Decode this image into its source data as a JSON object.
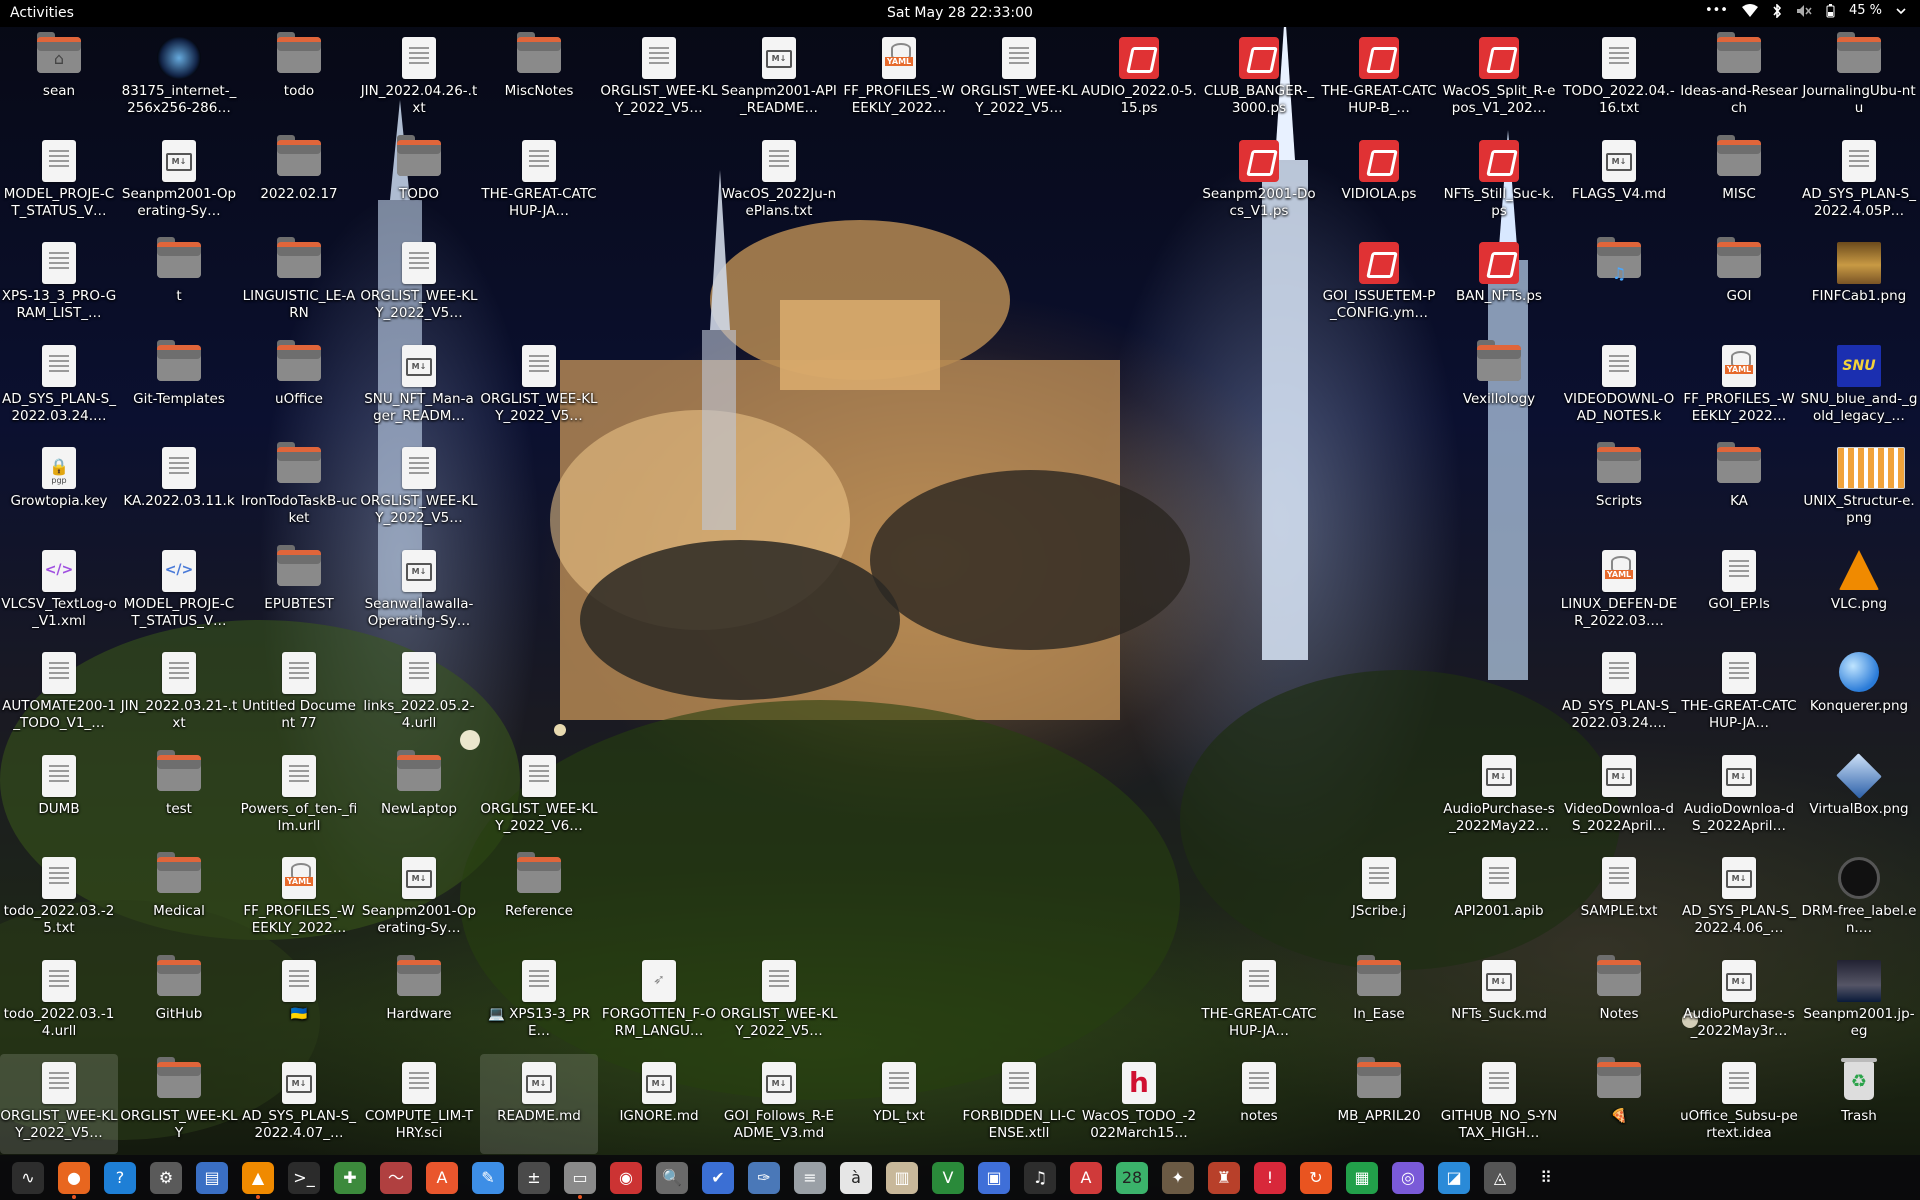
{
  "topbar": {
    "activities": "Activities",
    "clock": "Sat May 28  22:33:00",
    "menu_dots": "•••",
    "battery": "45 %"
  },
  "desktop_icons": [
    {
      "label": "sean",
      "icon": "home-folder-icon",
      "col": 0,
      "row": 0
    },
    {
      "label": "83175_internet-_256x256-286…",
      "icon": "internet-image-icon",
      "col": 1,
      "row": 0
    },
    {
      "label": "todo",
      "icon": "folder-icon",
      "col": 2,
      "row": 0
    },
    {
      "label": "JIN_2022.04.26-.txt",
      "icon": "text-file-icon",
      "col": 3,
      "row": 0
    },
    {
      "label": "MiscNotes",
      "icon": "folder-icon",
      "col": 4,
      "row": 0
    },
    {
      "label": "ORGLIST_WEE-KLY_2022_V5…",
      "icon": "text-file-icon",
      "col": 5,
      "row": 0
    },
    {
      "label": "Seanpm2001-API_README…",
      "icon": "markdown-file-icon",
      "col": 6,
      "row": 0
    },
    {
      "label": "FF_PROFILES_-WEEKLY_2022…",
      "icon": "yaml-file-icon",
      "col": 7,
      "row": 0
    },
    {
      "label": "ORGLIST_WEE-KLY_2022_V5…",
      "icon": "text-file-icon",
      "col": 8,
      "row": 0
    },
    {
      "label": "AUDIO_2022.0-5.15.ps",
      "icon": "postscript-file-icon",
      "col": 9,
      "row": 0
    },
    {
      "label": "CLUB_BANGER-_3000.ps",
      "icon": "postscript-file-icon",
      "col": 10,
      "row": 0
    },
    {
      "label": "THE-GREAT-CATCHUP-B_…",
      "icon": "postscript-file-icon",
      "col": 11,
      "row": 0
    },
    {
      "label": "WacOS_Split_R-epos_V1_202…",
      "icon": "postscript-file-icon",
      "col": 12,
      "row": 0
    },
    {
      "label": "TODO_2022.04.-16.txt",
      "icon": "text-file-icon",
      "col": 13,
      "row": 0
    },
    {
      "label": "Ideas-and-Research",
      "icon": "folder-icon",
      "col": 14,
      "row": 0
    },
    {
      "label": "JournalingUbu-ntu",
      "icon": "folder-icon",
      "col": 15,
      "row": 0
    },
    {
      "label": "MODEL_PROJE-CT_STATUS_V…",
      "icon": "text-file-icon",
      "col": 0,
      "row": 1
    },
    {
      "label": "Seanpm2001-Operating-Sy…",
      "icon": "markdown-file-icon",
      "col": 1,
      "row": 1
    },
    {
      "label": "2022.02.17",
      "icon": "folder-icon",
      "col": 2,
      "row": 1
    },
    {
      "label": "TODO",
      "icon": "folder-icon",
      "col": 3,
      "row": 1
    },
    {
      "label": "THE-GREAT-CATCHUP-JA…",
      "icon": "text-file-icon",
      "col": 4,
      "row": 1
    },
    {
      "label": "WacOS_2022Ju-nePlans.txt",
      "icon": "text-file-icon",
      "col": 6,
      "row": 1
    },
    {
      "label": "Seanpm2001-Docs_V1.ps",
      "icon": "postscript-file-icon",
      "col": 10,
      "row": 1
    },
    {
      "label": "VIDIOLA.ps",
      "icon": "postscript-file-icon",
      "col": 11,
      "row": 1
    },
    {
      "label": "NFTs_Still_Suc-k.ps",
      "icon": "postscript-file-icon",
      "col": 12,
      "row": 1
    },
    {
      "label": "FLAGS_V4.md",
      "icon": "markdown-file-icon",
      "col": 13,
      "row": 1
    },
    {
      "label": "MISC",
      "icon": "folder-icon",
      "col": 14,
      "row": 1
    },
    {
      "label": "AD_SYS_PLAN-S_2022.4.05P…",
      "icon": "text-file-icon",
      "col": 15,
      "row": 1
    },
    {
      "label": "XPS-13_3_PRO-GRAM_LIST_…",
      "icon": "text-file-icon",
      "col": 0,
      "row": 2
    },
    {
      "label": "t",
      "icon": "folder-icon",
      "col": 1,
      "row": 2
    },
    {
      "label": "LINGUISTIC_LE-ARN",
      "icon": "folder-icon",
      "col": 2,
      "row": 2
    },
    {
      "label": "ORGLIST_WEE-KLY_2022_V5…",
      "icon": "text-file-icon",
      "col": 3,
      "row": 2
    },
    {
      "label": "GOI_ISSUETEM-P_CONFIG.ym…",
      "icon": "postscript-file-icon",
      "col": 11,
      "row": 2
    },
    {
      "label": "BAN_NFTs.ps",
      "icon": "postscript-file-icon",
      "col": 12,
      "row": 2
    },
    {
      "label": "♫",
      "icon": "music-folder-icon",
      "col": 13,
      "row": 2
    },
    {
      "label": "GOI",
      "icon": "folder-icon",
      "col": 14,
      "row": 2
    },
    {
      "label": "FINFCab1.png",
      "icon": "cabinet-image-icon",
      "col": 15,
      "row": 2
    },
    {
      "label": "AD_SYS_PLAN-S_2022.03.24.…",
      "icon": "text-file-icon",
      "col": 0,
      "row": 3
    },
    {
      "label": "Git-Templates",
      "icon": "folder-icon",
      "col": 1,
      "row": 3
    },
    {
      "label": "uOffice",
      "icon": "folder-icon",
      "col": 2,
      "row": 3
    },
    {
      "label": "SNU_NFT_Man-ager_READM…",
      "icon": "markdown-file-icon",
      "col": 3,
      "row": 3
    },
    {
      "label": "ORGLIST_WEE-KLY_2022_V5…",
      "icon": "text-file-icon",
      "col": 4,
      "row": 3
    },
    {
      "label": "Vexillology",
      "icon": "folder-icon",
      "col": 12,
      "row": 3
    },
    {
      "label": "VIDEODOWNL-OAD_NOTES.k",
      "icon": "text-file-icon",
      "col": 13,
      "row": 3
    },
    {
      "label": "FF_PROFILES_-WEEKLY_2022…",
      "icon": "yaml-file-icon",
      "col": 14,
      "row": 3
    },
    {
      "label": "SNU_blue_and-_gold_legacy_…",
      "icon": "snu-image-icon",
      "col": 15,
      "row": 3
    },
    {
      "label": "Growtopia.key",
      "icon": "pgp-key-icon",
      "col": 0,
      "row": 4
    },
    {
      "label": "KA.2022.03.11.k",
      "icon": "text-file-icon",
      "col": 1,
      "row": 4
    },
    {
      "label": "IronTodoTaskB-ucket",
      "icon": "folder-icon",
      "col": 2,
      "row": 4
    },
    {
      "label": "ORGLIST_WEE-KLY_2022_V5…",
      "icon": "text-file-icon",
      "col": 3,
      "row": 4
    },
    {
      "label": "Scripts",
      "icon": "folder-icon",
      "col": 13,
      "row": 4
    },
    {
      "label": "KA",
      "icon": "folder-icon",
      "col": 14,
      "row": 4
    },
    {
      "label": "UNIX_Structur-e.png",
      "icon": "unix-image-icon",
      "col": 15,
      "row": 4
    },
    {
      "label": "VLCSV_TextLog-o_V1.xml",
      "icon": "xml-file-icon",
      "col": 0,
      "row": 5
    },
    {
      "label": "MODEL_PROJE-CT_STATUS_V…",
      "icon": "code-file-icon",
      "col": 1,
      "row": 5
    },
    {
      "label": "EPUBTEST",
      "icon": "folder-icon",
      "col": 2,
      "row": 5
    },
    {
      "label": "Seanwallawalla-Operating-Sy…",
      "icon": "markdown-file-icon",
      "col": 3,
      "row": 5
    },
    {
      "label": "LINUX_DEFEN-DER_2022.03.…",
      "icon": "yaml-file-icon",
      "col": 13,
      "row": 5
    },
    {
      "label": "GOI_EP.ls",
      "icon": "text-file-icon",
      "col": 14,
      "row": 5
    },
    {
      "label": "VLC.png",
      "icon": "vlc-cone-icon",
      "col": 15,
      "row": 5
    },
    {
      "label": "AUTOMATE200-1_TODO_V1_…",
      "icon": "text-file-icon",
      "col": 0,
      "row": 6
    },
    {
      "label": "JIN_2022.03.21-.txt",
      "icon": "text-file-icon",
      "col": 1,
      "row": 6
    },
    {
      "label": "Untitled Document 77",
      "icon": "text-file-icon",
      "col": 2,
      "row": 6
    },
    {
      "label": "links_2022.05.2-4.urll",
      "icon": "text-file-icon",
      "col": 3,
      "row": 6
    },
    {
      "label": "AD_SYS_PLAN-S_2022.03.24.…",
      "icon": "text-file-icon",
      "col": 13,
      "row": 6
    },
    {
      "label": "THE-GREAT-CATCHUP-JA…",
      "icon": "text-file-icon",
      "col": 14,
      "row": 6
    },
    {
      "label": "Konquerer.png",
      "icon": "konqueror-globe-icon",
      "col": 15,
      "row": 6
    },
    {
      "label": "DUMB",
      "icon": "text-file-icon",
      "col": 0,
      "row": 7
    },
    {
      "label": "test",
      "icon": "folder-icon",
      "col": 1,
      "row": 7
    },
    {
      "label": "Powers_of_ten-_film.urll",
      "icon": "text-file-icon",
      "col": 2,
      "row": 7
    },
    {
      "label": "NewLaptop",
      "icon": "folder-icon",
      "col": 3,
      "row": 7
    },
    {
      "label": "ORGLIST_WEE-KLY_2022_V6…",
      "icon": "text-file-icon",
      "col": 4,
      "row": 7
    },
    {
      "label": "AudioPurchase-s_2022May22…",
      "icon": "markdown-file-icon",
      "col": 12,
      "row": 7
    },
    {
      "label": "VideoDownloa-dS_2022April…",
      "icon": "markdown-file-icon",
      "col": 13,
      "row": 7
    },
    {
      "label": "AudioDownloa-dS_2022April…",
      "icon": "markdown-file-icon",
      "col": 14,
      "row": 7
    },
    {
      "label": "VirtualBox.png",
      "icon": "virtualbox-cube-icon",
      "col": 15,
      "row": 7
    },
    {
      "label": "todo_2022.03.-25.txt",
      "icon": "text-file-icon",
      "col": 0,
      "row": 8
    },
    {
      "label": "Medical",
      "icon": "folder-icon",
      "col": 1,
      "row": 8
    },
    {
      "label": "FF_PROFILES_-WEEKLY_2022…",
      "icon": "yaml-file-icon",
      "col": 2,
      "row": 8
    },
    {
      "label": "Seanpm2001-Operating-Sy…",
      "icon": "markdown-file-icon",
      "col": 3,
      "row": 8
    },
    {
      "label": "Reference",
      "icon": "folder-icon",
      "col": 4,
      "row": 8
    },
    {
      "label": "JScribe.j",
      "icon": "text-file-icon",
      "col": 11,
      "row": 8
    },
    {
      "label": "API2001.apib",
      "icon": "text-file-icon",
      "col": 12,
      "row": 8
    },
    {
      "label": "SAMPLE.txt",
      "icon": "text-file-icon",
      "col": 13,
      "row": 8
    },
    {
      "label": "AD_SYS_PLAN-S_2022.4.06_…",
      "icon": "markdown-file-icon",
      "col": 14,
      "row": 8
    },
    {
      "label": "DRM-free_label.en.…",
      "icon": "drm-free-image-icon",
      "col": 15,
      "row": 8
    },
    {
      "label": "todo_2022.03.-14.urll",
      "icon": "text-file-icon",
      "col": 0,
      "row": 9
    },
    {
      "label": "GitHub",
      "icon": "folder-icon",
      "col": 1,
      "row": 9
    },
    {
      "label": "🇺🇦",
      "icon": "text-file-icon",
      "col": 2,
      "row": 9
    },
    {
      "label": "Hardware",
      "icon": "folder-icon",
      "col": 3,
      "row": 9
    },
    {
      "label": "💻 XPS13-3_PRE…",
      "icon": "text-file-icon",
      "col": 4,
      "row": 9
    },
    {
      "label": "FORGOTTEN_F-ORM_LANGU…",
      "icon": "feather-file-icon",
      "col": 5,
      "row": 9
    },
    {
      "label": "ORGLIST_WEE-KLY_2022_V5…",
      "icon": "text-file-icon",
      "col": 6,
      "row": 9
    },
    {
      "label": "THE-GREAT-CATCHUP-JA…",
      "icon": "text-file-icon",
      "col": 10,
      "row": 9
    },
    {
      "label": "In_Ease",
      "icon": "folder-icon",
      "col": 11,
      "row": 9
    },
    {
      "label": "NFTs_Suck.md",
      "icon": "markdown-file-icon",
      "col": 12,
      "row": 9
    },
    {
      "label": "Notes",
      "icon": "folder-icon",
      "col": 13,
      "row": 9
    },
    {
      "label": "AudioPurchase-s_2022May3r…",
      "icon": "markdown-file-icon",
      "col": 14,
      "row": 9
    },
    {
      "label": "Seanpm2001.jp-eg",
      "icon": "photo-image-icon",
      "col": 15,
      "row": 9
    },
    {
      "label": "ORGLIST_WEE-KLY_2022_V5…",
      "icon": "text-file-icon",
      "col": 0,
      "row": 10,
      "selected": true
    },
    {
      "label": "ORGLIST_WEE-KLY",
      "icon": "folder-icon",
      "col": 1,
      "row": 10
    },
    {
      "label": "AD_SYS_PLAN-S_2022.4.07_…",
      "icon": "markdown-file-icon",
      "col": 2,
      "row": 10
    },
    {
      "label": "COMPUTE_LIM-THRY.sci",
      "icon": "text-file-icon",
      "col": 3,
      "row": 10
    },
    {
      "label": "README.md",
      "icon": "markdown-file-icon",
      "col": 4,
      "row": 10,
      "selected": true
    },
    {
      "label": "IGNORE.md",
      "icon": "markdown-file-icon",
      "col": 5,
      "row": 10
    },
    {
      "label": "GOI_Follows_R-EADME_V3.md",
      "icon": "markdown-file-icon",
      "col": 6,
      "row": 10
    },
    {
      "label": "YDL_txt",
      "icon": "text-file-icon",
      "col": 7,
      "row": 10
    },
    {
      "label": "FORBIDDEN_LI-CENSE.xtll",
      "icon": "text-file-icon",
      "col": 8,
      "row": 10
    },
    {
      "label": "WacOS_TODO_-2022March15…",
      "icon": "h-file-icon",
      "col": 9,
      "row": 10
    },
    {
      "label": "notes",
      "icon": "text-file-icon",
      "col": 10,
      "row": 10
    },
    {
      "label": "MB_APRIL20",
      "icon": "folder-icon",
      "col": 11,
      "row": 10
    },
    {
      "label": "GITHUB_NO_S-YNTAX_HIGH…",
      "icon": "text-file-icon",
      "col": 12,
      "row": 10
    },
    {
      "label": "🍕",
      "icon": "folder-icon",
      "col": 13,
      "row": 10
    },
    {
      "label": "uOffice_Subsu-pertext.idea",
      "icon": "text-file-icon",
      "col": 14,
      "row": 10
    },
    {
      "label": "Trash",
      "icon": "trash-icon",
      "col": 15,
      "row": 10
    }
  ],
  "dock": [
    {
      "name": "system-monitor-icon",
      "glyph": "∿",
      "bg": "#2d2d2d"
    },
    {
      "name": "firefox-icon",
      "glyph": "●",
      "bg": "#e8661f",
      "running": true
    },
    {
      "name": "help-icon",
      "glyph": "?",
      "bg": "#1e7fd6"
    },
    {
      "name": "settings-gear-icon",
      "glyph": "⚙",
      "bg": "#5a5a5a"
    },
    {
      "name": "document-viewer-icon",
      "glyph": "▤",
      "bg": "#3a6fc4"
    },
    {
      "name": "vlc-icon",
      "glyph": "▲",
      "bg": "#f08a00",
      "running": true
    },
    {
      "name": "terminal-icon",
      "glyph": ">_",
      "bg": "#2b2b2b"
    },
    {
      "name": "extension-manager-icon",
      "glyph": "✚",
      "bg": "#3c8a3c"
    },
    {
      "name": "oscilloscope-icon",
      "glyph": "〜",
      "bg": "#b04040"
    },
    {
      "name": "software-center-icon",
      "glyph": "A",
      "bg": "#e9562d"
    },
    {
      "name": "text-editor-icon",
      "glyph": "✎",
      "bg": "#3d8ee6"
    },
    {
      "name": "calculator-icon",
      "glyph": "±",
      "bg": "#4a4a4a"
    },
    {
      "name": "files-icon",
      "glyph": "▭",
      "bg": "#8a8a8a",
      "running": true
    },
    {
      "name": "disk-usage-icon",
      "glyph": "◉",
      "bg": "#c33"
    },
    {
      "name": "search-tool-icon",
      "glyph": "🔍",
      "bg": "#6a6a6a"
    },
    {
      "name": "tasks-icon",
      "glyph": "✔",
      "bg": "#3b6fd4"
    },
    {
      "name": "scanner-icon",
      "glyph": "✑",
      "bg": "#4a78b8"
    },
    {
      "name": "office-icon",
      "glyph": "≡",
      "bg": "#9aa0a6"
    },
    {
      "name": "character-map-icon",
      "glyph": "à",
      "bg": "#e6e6e6"
    },
    {
      "name": "archive-manager-icon",
      "glyph": "▥",
      "bg": "#c8b89a"
    },
    {
      "name": "vim-icon",
      "glyph": "V",
      "bg": "#2a8a3a"
    },
    {
      "name": "screen-icon",
      "glyph": "▣",
      "bg": "#3f6fd8"
    },
    {
      "name": "music-icon",
      "glyph": "♫",
      "bg": "#2d2d2d"
    },
    {
      "name": "pdf-icon",
      "glyph": "A",
      "bg": "#d03a3a"
    },
    {
      "name": "calendar-icon",
      "glyph": "28",
      "bg": "#3bb36b"
    },
    {
      "name": "gimp-icon",
      "glyph": "✦",
      "bg": "#6b5a44"
    },
    {
      "name": "game-icon",
      "glyph": "♜",
      "bg": "#b8402a"
    },
    {
      "name": "alert-icon",
      "glyph": "!",
      "bg": "#d8283a"
    },
    {
      "name": "update-icon",
      "glyph": "↻",
      "bg": "#e95420"
    },
    {
      "name": "spreadsheet-icon",
      "glyph": "▦",
      "bg": "#22a04a"
    },
    {
      "name": "screenshot-icon",
      "glyph": "◎",
      "bg": "#7a5ad8"
    },
    {
      "name": "chart-app-icon",
      "glyph": "◪",
      "bg": "#2a8ad8"
    },
    {
      "name": "store-icon",
      "glyph": "◬",
      "bg": "#555"
    },
    {
      "name": "app-grid-icon",
      "glyph": "⠿",
      "bg": "transparent"
    }
  ]
}
